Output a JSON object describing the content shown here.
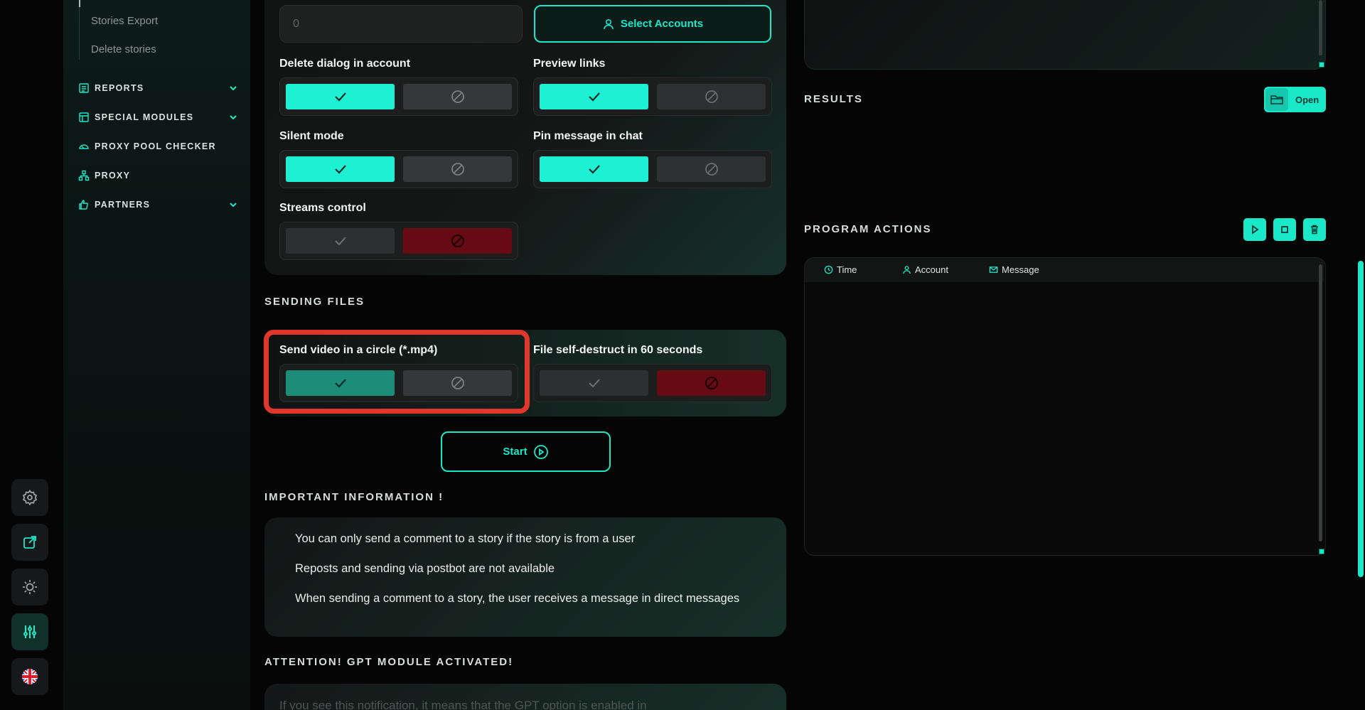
{
  "sidebar": {
    "sub_items": [
      "Stories Export",
      "Delete stories"
    ],
    "items": [
      {
        "label": "REPORTS",
        "icon": "report-icon",
        "has_chevron": true
      },
      {
        "label": "SPECIAL MODULES",
        "icon": "modules-icon",
        "has_chevron": true
      },
      {
        "label": "PROXY POOL CHECKER",
        "icon": "pool-icon",
        "has_chevron": false
      },
      {
        "label": "PROXY",
        "icon": "network-icon",
        "has_chevron": false
      },
      {
        "label": "PARTNERS",
        "icon": "hand-icon",
        "has_chevron": true
      }
    ]
  },
  "rail": {
    "buttons": [
      "settings-icon",
      "external-link-icon",
      "theme-icon",
      "sliders-icon",
      "flag-uk-icon"
    ]
  },
  "form": {
    "count_value": "0",
    "select_accounts_label": "Select Accounts",
    "options": {
      "delete_dialog": {
        "label": "Delete dialog in account",
        "value": true
      },
      "preview_links": {
        "label": "Preview links",
        "value": true
      },
      "silent_mode": {
        "label": "Silent mode",
        "value": true
      },
      "pin_message": {
        "label": "Pin message in chat",
        "value": true
      },
      "streams_control": {
        "label": "Streams control",
        "value": false
      }
    }
  },
  "sending_files": {
    "title": "SENDING FILES",
    "video_circle": {
      "label": "Send video in a circle (*.mp4)",
      "value": true
    },
    "self_destruct": {
      "label": "File self-destruct in 60 seconds",
      "value": false
    }
  },
  "start_label": "Start",
  "important": {
    "title": "IMPORTANT INFORMATION !",
    "lines": [
      "You can only send a comment to a story if the story is from a user",
      "Reposts and sending via postbot are not available",
      "When sending a comment to a story, the user receives a message in direct messages"
    ]
  },
  "gpt": {
    "title": "ATTENTION! GPT MODULE ACTIVATED!",
    "text": "If you see this notification, it means that the GPT option is enabled in"
  },
  "results": {
    "title": "RESULTS",
    "open_label": "Open"
  },
  "program_actions": {
    "title": "PROGRAM ACTIONS",
    "columns": [
      "Time",
      "Account",
      "Message"
    ]
  },
  "colors": {
    "accent": "#19e8c9",
    "danger": "#670a14",
    "highlight": "#e0362c"
  }
}
